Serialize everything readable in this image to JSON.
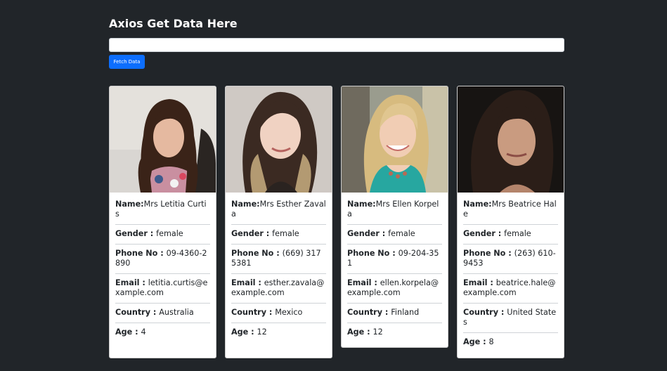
{
  "page": {
    "title": "Axios Get Data Here",
    "input_value": "",
    "button_label": "Fetch Data"
  },
  "users": [
    {
      "name_label": "Name:",
      "name": "Mrs Letitia Curtis",
      "gender_label": "Gender : ",
      "gender": "female",
      "phone_label": "Phone No : ",
      "phone": "09-4360-2890",
      "email_label": "Email : ",
      "email": "letitia.curtis@example.com",
      "country_label": "Country : ",
      "country": "Australia",
      "age_label": "Age : ",
      "age": "4",
      "photo": "woman with long dark curly hair, floral top"
    },
    {
      "name_label": "Name:",
      "name": "Mrs Esther Zavala",
      "gender_label": "Gender : ",
      "gender": "female",
      "phone_label": "Phone No : ",
      "phone": "(669) 317 5381",
      "email_label": "Email : ",
      "email": "esther.zavala@example.com",
      "country_label": "Country : ",
      "country": "Mexico",
      "age_label": "Age : ",
      "age": "12",
      "photo": "woman with brown ombre hair, light background"
    },
    {
      "name_label": "Name:",
      "name": "Mrs Ellen Korpela",
      "gender_label": "Gender : ",
      "gender": "female",
      "phone_label": "Phone No : ",
      "phone": "09-204-351",
      "email_label": "Email : ",
      "email": "ellen.korpela@example.com",
      "country_label": "Country : ",
      "country": "Finland",
      "age_label": "Age : ",
      "age": "12",
      "photo": "smiling woman with blonde hair, teal top"
    },
    {
      "name_label": "Name:",
      "name": "Mrs Beatrice Hale",
      "gender_label": "Gender : ",
      "gender": "female",
      "phone_label": "Phone No : ",
      "phone": "(263) 610-9453",
      "email_label": "Email : ",
      "email": "beatrice.hale@example.com",
      "country_label": "Country : ",
      "country": "United States",
      "age_label": "Age : ",
      "age": "8",
      "photo": "woman with long dark straight hair, dark background"
    }
  ]
}
